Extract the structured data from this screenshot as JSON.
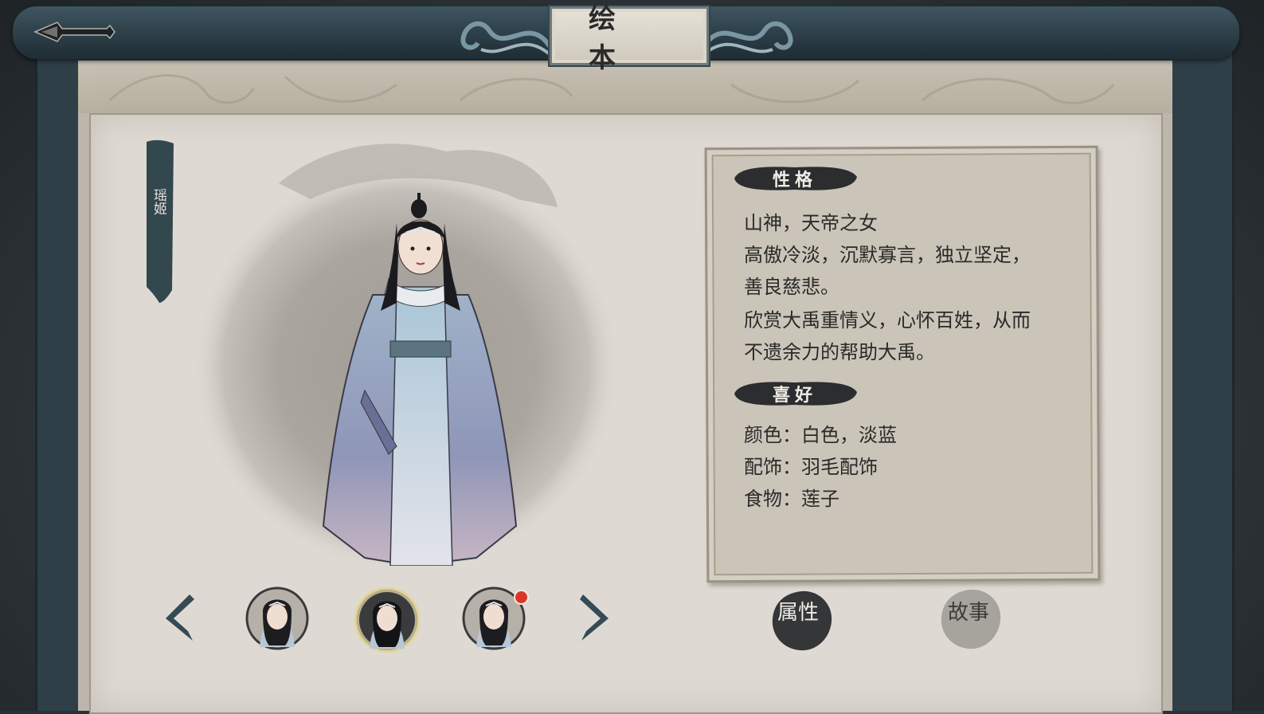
{
  "header": {
    "title": "绘 本"
  },
  "character": {
    "name": "瑶姬"
  },
  "personality": {
    "label": "性格",
    "lines": [
      "山神，天帝之女",
      "高傲冷淡，沉默寡言，独立坚定，",
      "善良慈悲。",
      "欣赏大禹重情义，心怀百姓，从而",
      "不遗余力的帮助大禹。"
    ]
  },
  "preferences": {
    "label": "喜好",
    "lines": [
      "颜色：白色，淡蓝",
      "配饰：羽毛配饰",
      "食物：莲子"
    ]
  },
  "tabs": {
    "attributes": "属性",
    "story": "故事"
  },
  "portraits": [
    {
      "selected": false,
      "new": false
    },
    {
      "selected": true,
      "new": false
    },
    {
      "selected": false,
      "new": true
    }
  ],
  "colors": {
    "frame": "#2f3f47",
    "paper": "#dedad3",
    "ink": "#2a2a2a",
    "badge": "#d9362a"
  }
}
